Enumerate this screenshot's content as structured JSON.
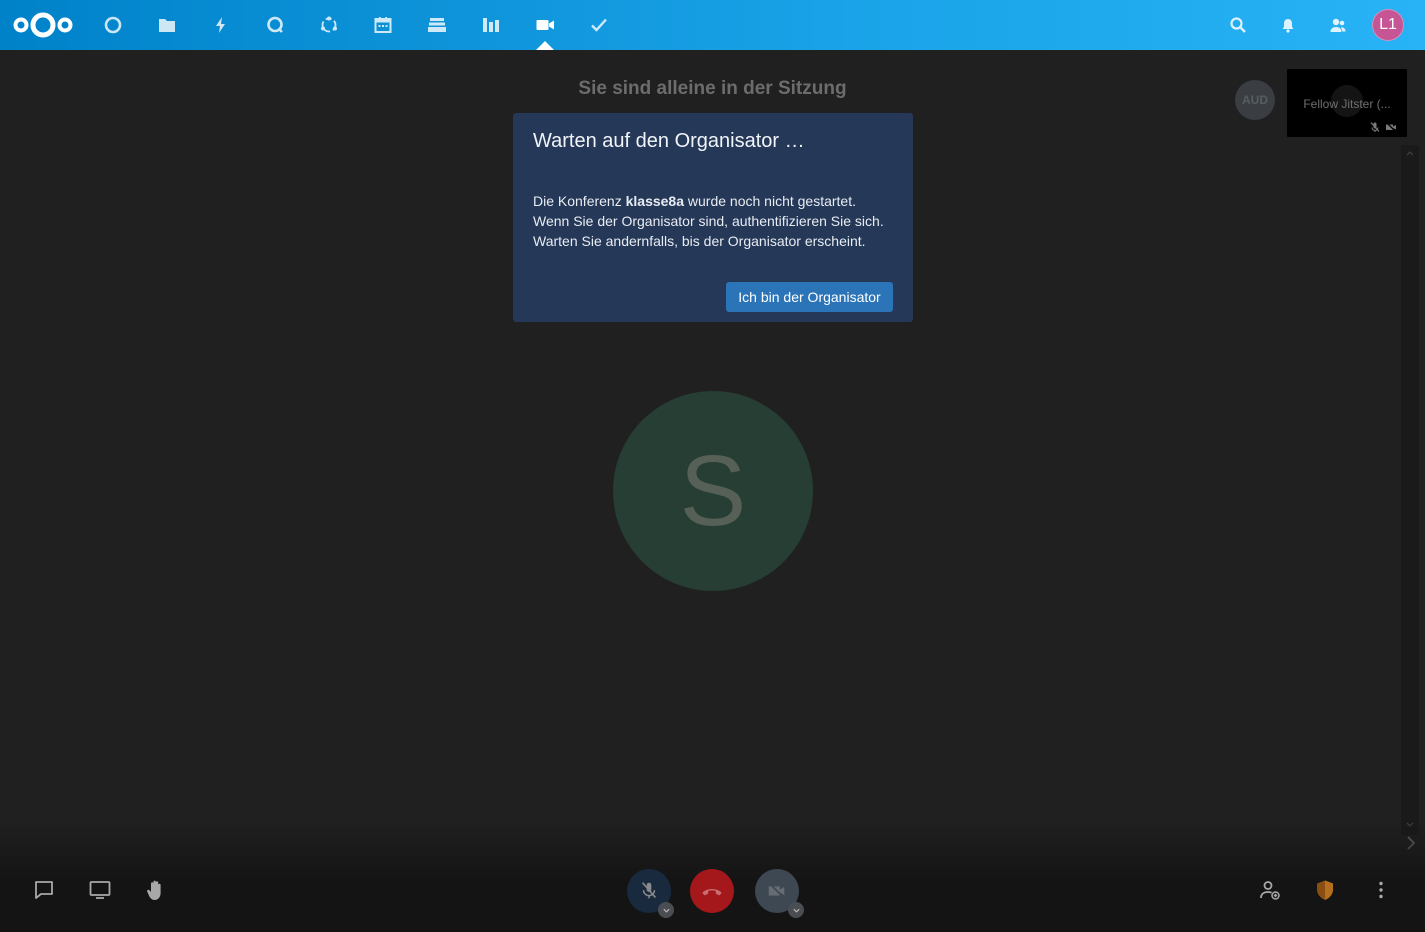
{
  "header": {
    "apps": [
      {
        "name": "dashboard",
        "icon": "circle-icon"
      },
      {
        "name": "files",
        "icon": "folder-icon"
      },
      {
        "name": "activity",
        "icon": "lightning-icon"
      },
      {
        "name": "talk",
        "icon": "chat-bubble-icon"
      },
      {
        "name": "contacts",
        "icon": "circles-icon"
      },
      {
        "name": "calendar",
        "icon": "calendar-icon"
      },
      {
        "name": "deck",
        "icon": "stack-icon"
      },
      {
        "name": "analytics",
        "icon": "bar-chart-icon"
      },
      {
        "name": "jitsi",
        "icon": "video-camera-icon",
        "active": true
      },
      {
        "name": "tasks",
        "icon": "checkmark-icon"
      }
    ],
    "user_initials": "L1",
    "user_color": "#c55594"
  },
  "stage": {
    "alone_message": "Sie sind alleine in der Sitzung",
    "participant_initial": "S",
    "aud_badge": "AUD",
    "local_name": "Fellow Jitster (..."
  },
  "dialog": {
    "title": "Warten auf den Organisator …",
    "body_prefix": "Die Konferenz ",
    "room_name": "klasse8a",
    "body_line1_suffix": " wurde noch nicht gestartet.",
    "body_line2": "Wenn Sie der Organisator sind, authentifizieren Sie sich.",
    "body_line3": "Warten Sie andernfalls, bis der Organisator erscheint.",
    "button_label": "Ich bin der Organisator"
  },
  "colors": {
    "header_gradient_start": "#0082c9",
    "dialog_bg": "#253858",
    "button_bg": "#2b74b8",
    "hangup": "#a4181b"
  }
}
